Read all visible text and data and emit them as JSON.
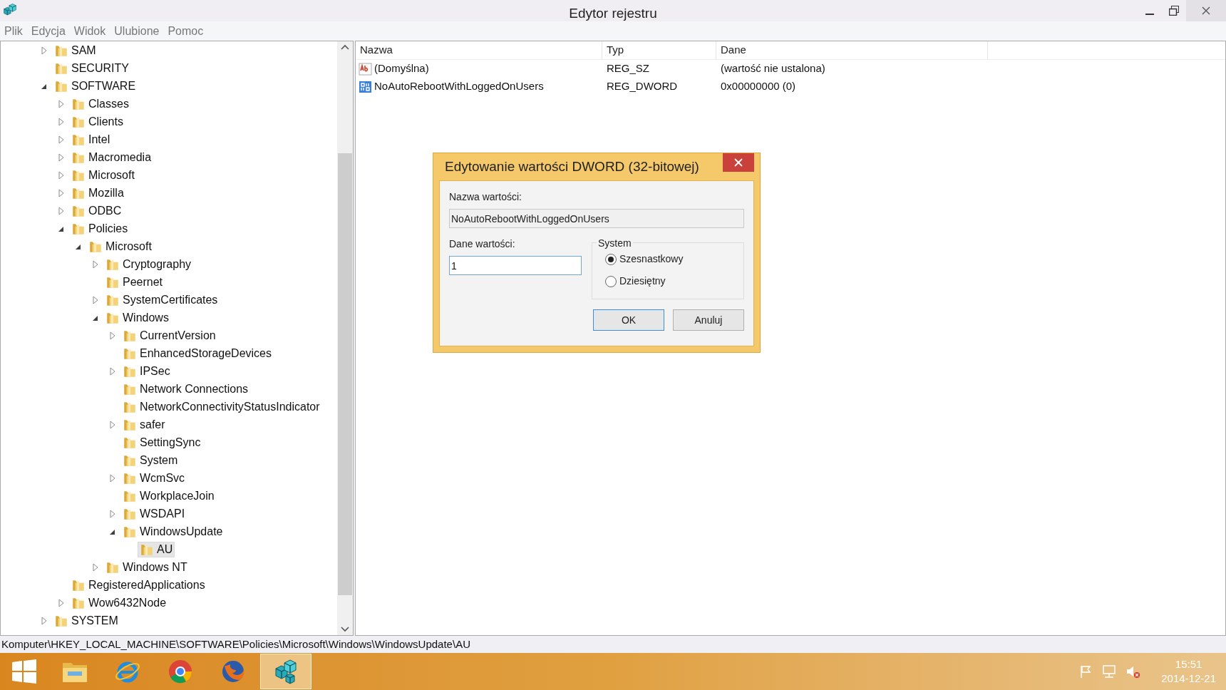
{
  "window": {
    "title": "Edytor rejestru"
  },
  "menu": [
    "Plik",
    "Edycja",
    "Widok",
    "Ulubione",
    "Pomoc"
  ],
  "tree": [
    {
      "label": "SAM",
      "expandable": true,
      "expanded": false,
      "selected": false
    },
    {
      "label": "SECURITY",
      "expandable": false,
      "expanded": false,
      "selected": false
    },
    {
      "label": "SOFTWARE",
      "expandable": true,
      "expanded": true,
      "selected": false,
      "children": [
        {
          "label": "Classes",
          "expandable": true,
          "expanded": false,
          "selected": false
        },
        {
          "label": "Clients",
          "expandable": true,
          "expanded": false,
          "selected": false
        },
        {
          "label": "Intel",
          "expandable": true,
          "expanded": false,
          "selected": false
        },
        {
          "label": "Macromedia",
          "expandable": true,
          "expanded": false,
          "selected": false
        },
        {
          "label": "Microsoft",
          "expandable": true,
          "expanded": false,
          "selected": false
        },
        {
          "label": "Mozilla",
          "expandable": true,
          "expanded": false,
          "selected": false
        },
        {
          "label": "ODBC",
          "expandable": true,
          "expanded": false,
          "selected": false
        },
        {
          "label": "Policies",
          "expandable": true,
          "expanded": true,
          "selected": false,
          "children": [
            {
              "label": "Microsoft",
              "expandable": true,
              "expanded": true,
              "selected": false,
              "children": [
                {
                  "label": "Cryptography",
                  "expandable": true,
                  "expanded": false,
                  "selected": false
                },
                {
                  "label": "Peernet",
                  "expandable": false,
                  "expanded": false,
                  "selected": false
                },
                {
                  "label": "SystemCertificates",
                  "expandable": true,
                  "expanded": false,
                  "selected": false
                },
                {
                  "label": "Windows",
                  "expandable": true,
                  "expanded": true,
                  "selected": false,
                  "children": [
                    {
                      "label": "CurrentVersion",
                      "expandable": true,
                      "expanded": false,
                      "selected": false
                    },
                    {
                      "label": "EnhancedStorageDevices",
                      "expandable": false,
                      "expanded": false,
                      "selected": false
                    },
                    {
                      "label": "IPSec",
                      "expandable": true,
                      "expanded": false,
                      "selected": false
                    },
                    {
                      "label": "Network Connections",
                      "expandable": false,
                      "expanded": false,
                      "selected": false
                    },
                    {
                      "label": "NetworkConnectivityStatusIndicator",
                      "expandable": false,
                      "expanded": false,
                      "selected": false
                    },
                    {
                      "label": "safer",
                      "expandable": true,
                      "expanded": false,
                      "selected": false
                    },
                    {
                      "label": "SettingSync",
                      "expandable": false,
                      "expanded": false,
                      "selected": false
                    },
                    {
                      "label": "System",
                      "expandable": false,
                      "expanded": false,
                      "selected": false
                    },
                    {
                      "label": "WcmSvc",
                      "expandable": true,
                      "expanded": false,
                      "selected": false
                    },
                    {
                      "label": "WorkplaceJoin",
                      "expandable": false,
                      "expanded": false,
                      "selected": false
                    },
                    {
                      "label": "WSDAPI",
                      "expandable": true,
                      "expanded": false,
                      "selected": false
                    },
                    {
                      "label": "WindowsUpdate",
                      "expandable": true,
                      "expanded": true,
                      "selected": false,
                      "children": [
                        {
                          "label": "AU",
                          "expandable": false,
                          "expanded": false,
                          "selected": true
                        }
                      ]
                    }
                  ]
                },
                {
                  "label": "Windows NT",
                  "expandable": true,
                  "expanded": false,
                  "selected": false
                }
              ]
            }
          ]
        },
        {
          "label": "RegisteredApplications",
          "expandable": false,
          "expanded": false,
          "selected": false
        },
        {
          "label": "Wow6432Node",
          "expandable": true,
          "expanded": false,
          "selected": false
        }
      ]
    },
    {
      "label": "SYSTEM",
      "expandable": true,
      "expanded": false,
      "selected": false
    }
  ],
  "values": {
    "columns": [
      "Nazwa",
      "Typ",
      "Dane"
    ],
    "rows": [
      {
        "kind": "string",
        "name": "(Domyślna)",
        "type": "REG_SZ",
        "data": "(wartość nie ustalona)"
      },
      {
        "kind": "binary",
        "name": "NoAutoRebootWithLoggedOnUsers",
        "type": "REG_DWORD",
        "data": "0x00000000 (0)"
      }
    ]
  },
  "dialog": {
    "title": "Edytowanie wartości DWORD (32-bitowej)",
    "name_label": "Nazwa wartości:",
    "name_value": "NoAutoRebootWithLoggedOnUsers",
    "data_label": "Dane wartości:",
    "data_value": "1",
    "group_label": "System",
    "radios": [
      {
        "label": "Szesnastkowy",
        "selected": true
      },
      {
        "label": "Dziesiętny",
        "selected": false
      }
    ],
    "buttons": [
      {
        "label": "OK",
        "default": true
      },
      {
        "label": "Anuluj",
        "default": false
      }
    ]
  },
  "status_bar": "Komputer\\HKEY_LOCAL_MACHINE\\SOFTWARE\\Policies\\Microsoft\\Windows\\WindowsUpdate\\AU",
  "taskbar": {
    "apps": [
      {
        "kind": "explorer",
        "active": false
      },
      {
        "kind": "ie",
        "active": false
      },
      {
        "kind": "chrome",
        "active": false
      },
      {
        "kind": "firefox",
        "active": false
      },
      {
        "kind": "regedit",
        "active": true
      }
    ],
    "time": "15:51",
    "date": "2014-12-21"
  }
}
